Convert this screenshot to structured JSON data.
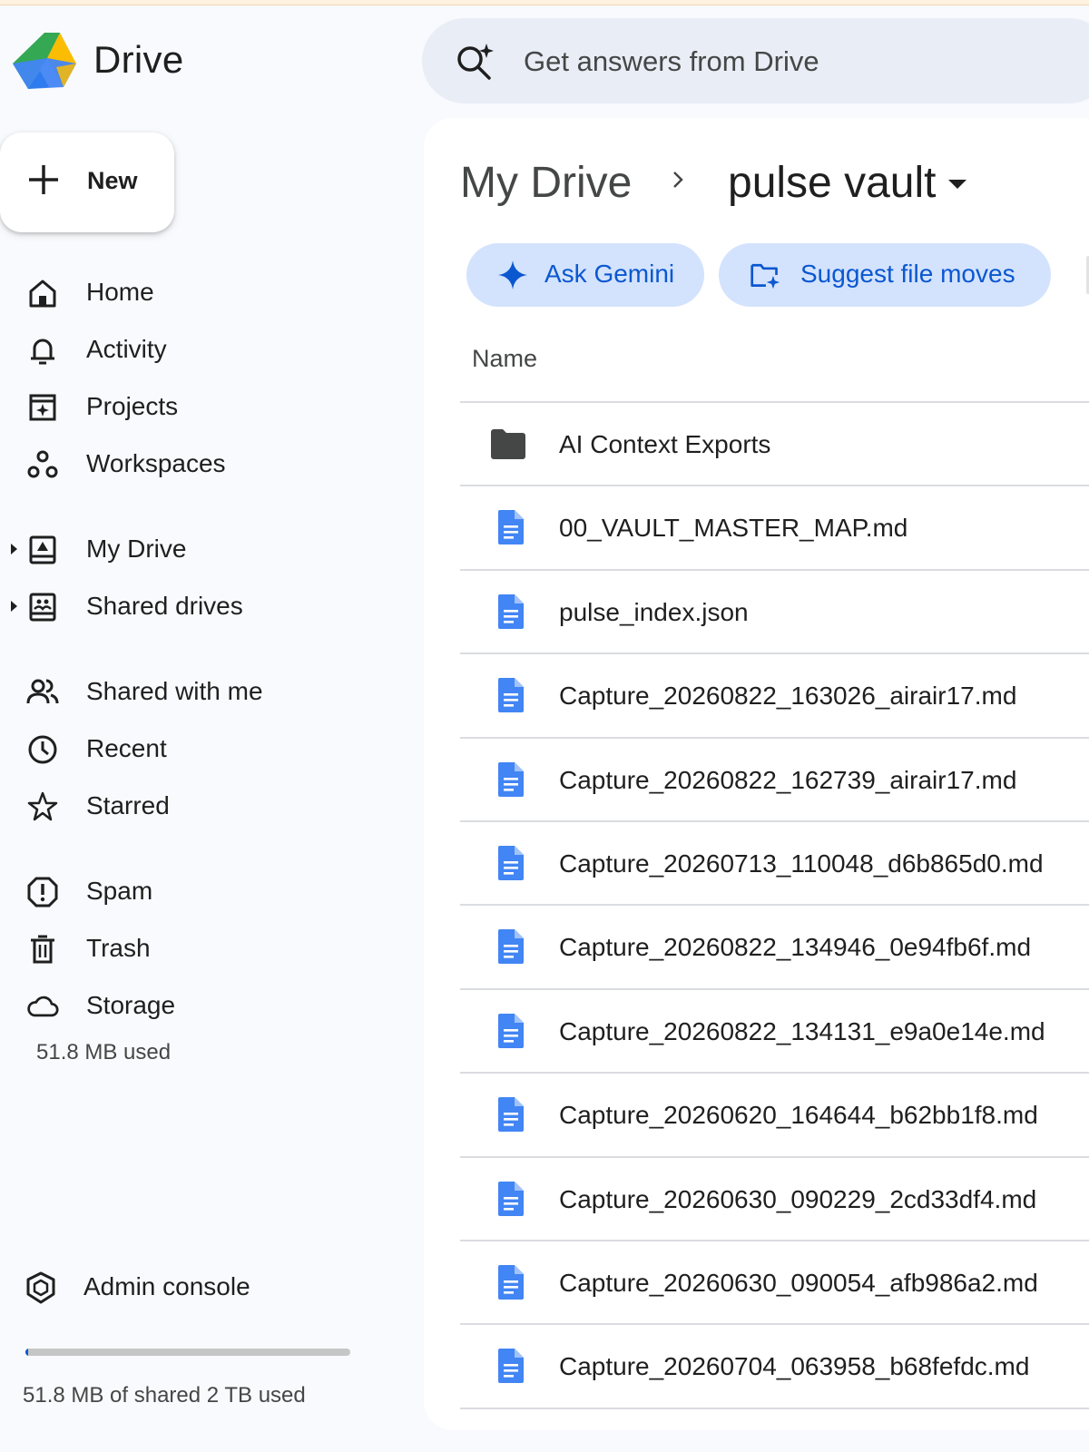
{
  "app": {
    "name": "Drive"
  },
  "search": {
    "placeholder": "Get answers from Drive"
  },
  "new_button": {
    "label": "New"
  },
  "sidebar": {
    "items": [
      {
        "id": "home",
        "label": "Home",
        "icon": "home-icon"
      },
      {
        "id": "activity",
        "label": "Activity",
        "icon": "bell-icon"
      },
      {
        "id": "projects",
        "label": "Projects",
        "icon": "projects-icon"
      },
      {
        "id": "workspaces",
        "label": "Workspaces",
        "icon": "workspaces-icon"
      },
      {
        "id": "my-drive",
        "label": "My Drive",
        "icon": "my-drive-icon",
        "expandable": true
      },
      {
        "id": "shared-drives",
        "label": "Shared drives",
        "icon": "shared-drives-icon",
        "expandable": true
      },
      {
        "id": "shared-with-me",
        "label": "Shared with me",
        "icon": "people-icon"
      },
      {
        "id": "recent",
        "label": "Recent",
        "icon": "clock-icon"
      },
      {
        "id": "starred",
        "label": "Starred",
        "icon": "star-icon"
      },
      {
        "id": "spam",
        "label": "Spam",
        "icon": "spam-icon"
      },
      {
        "id": "trash",
        "label": "Trash",
        "icon": "trash-icon"
      },
      {
        "id": "storage",
        "label": "Storage",
        "icon": "cloud-icon"
      }
    ],
    "storage_used": "51.8 MB used",
    "admin_console": "Admin console",
    "quota_text": "51.8 MB of shared 2 TB used",
    "quota_fraction": 3e-05
  },
  "breadcrumb": {
    "root": "My Drive",
    "current": "pulse vault"
  },
  "chips": {
    "ask_gemini": "Ask Gemini",
    "suggest_moves": "Suggest file moves"
  },
  "table": {
    "column_name": "Name",
    "rows": [
      {
        "name": "AI Context Exports",
        "type": "folder"
      },
      {
        "name": "00_VAULT_MASTER_MAP.md",
        "type": "doc"
      },
      {
        "name": "pulse_index.json",
        "type": "doc"
      },
      {
        "name": "Capture_20260822_163026_airair17.md",
        "type": "doc"
      },
      {
        "name": "Capture_20260822_162739_airair17.md",
        "type": "doc"
      },
      {
        "name": "Capture_20260713_110048_d6b865d0.md",
        "type": "doc"
      },
      {
        "name": "Capture_20260822_134946_0e94fb6f.md",
        "type": "doc"
      },
      {
        "name": "Capture_20260822_134131_e9a0e14e.md",
        "type": "doc"
      },
      {
        "name": "Capture_20260620_164644_b62bb1f8.md",
        "type": "doc"
      },
      {
        "name": "Capture_20260630_090229_2cd33df4.md",
        "type": "doc"
      },
      {
        "name": "Capture_20260630_090054_afb986a2.md",
        "type": "doc"
      },
      {
        "name": "Capture_20260704_063958_b68fefdc.md",
        "type": "doc"
      }
    ]
  },
  "colors": {
    "accent": "#0b57d0",
    "chip_bg": "#d3e3fd",
    "doc_blue": "#4285f4",
    "search_bg": "#e9eef6",
    "page_bg": "#f8fafd"
  }
}
